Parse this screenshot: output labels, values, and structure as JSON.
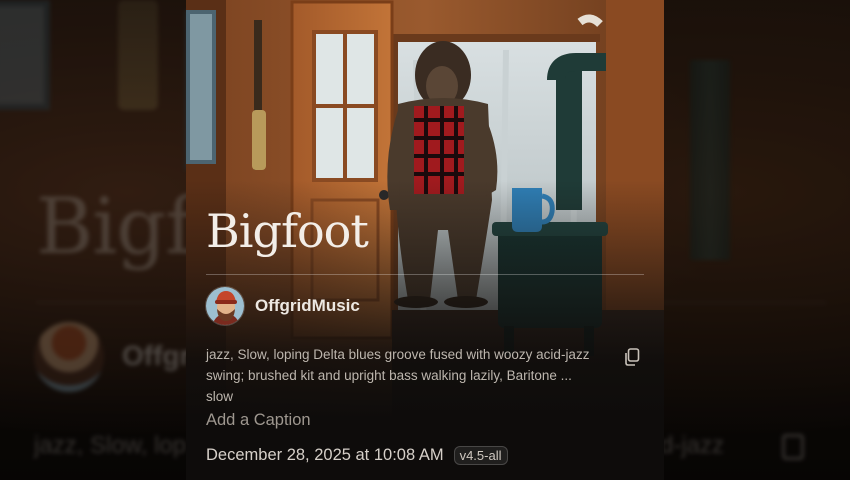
{
  "song": {
    "title": "Bigfoot",
    "artist": "OffgridMusic",
    "description": "jazz, Slow, loping Delta blues groove fused with woozy acid-jazz swing; brushed kit and upright bass walking lazily, Baritone ... slow",
    "caption_placeholder": "Add a Caption",
    "date": "December 28, 2025 at 10:08 AM",
    "model_badge": "v4.5-all"
  },
  "background": {
    "title": "Bigfo",
    "artist": "Offgr",
    "description_left": "jazz, Slow, lop",
    "description_right": "d-jazz"
  },
  "icons": {
    "copy": "copy-icon",
    "avatar": "lumberjack-avatar"
  },
  "colors": {
    "card_bg": "#0e0c0b",
    "title": "#f3eee8",
    "text_muted": "#bdb6ae"
  }
}
